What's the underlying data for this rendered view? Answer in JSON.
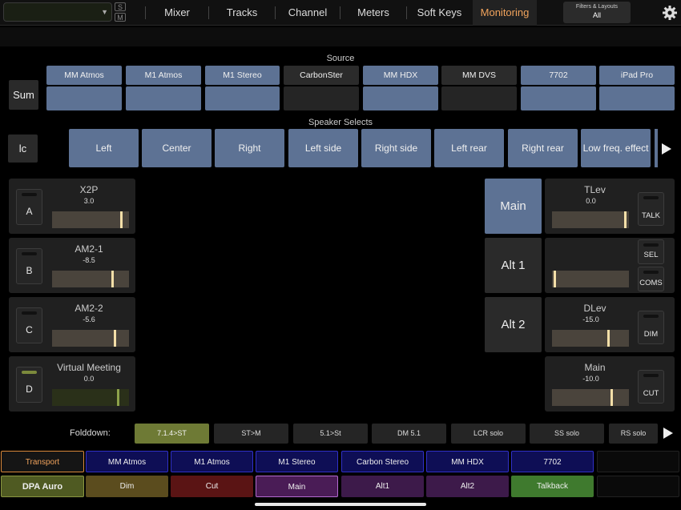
{
  "topbar": {
    "dropdown_value": "",
    "s_label": "S",
    "m_label": "M",
    "tabs": [
      "Mixer",
      "Tracks",
      "Channel",
      "Meters",
      "Soft Keys",
      "Monitoring"
    ],
    "filters_title": "Filters & Layouts",
    "filters_value": "All"
  },
  "source": {
    "title": "Source",
    "sum_label": "Sum",
    "buttons": [
      "MM Atmos",
      "M1 Atmos",
      "M1 Stereo",
      "CarbonSter",
      "MM HDX",
      "MM DVS",
      "7702",
      "iPad Pro"
    ]
  },
  "speakers": {
    "title": "Speaker Selects",
    "side_label": "lc",
    "buttons": [
      "Left",
      "Center",
      "Right",
      "Left side",
      "Right side",
      "Left rear",
      "Right rear",
      "Low freq. effect"
    ]
  },
  "inputs": [
    {
      "letter": "A",
      "name": "X2P",
      "value": "3.0",
      "level": 0.91
    },
    {
      "letter": "B",
      "name": "AM2-1",
      "value": "-8.5",
      "level": 0.8
    },
    {
      "letter": "C",
      "name": "AM2-2",
      "value": "-5.6",
      "level": 0.83
    },
    {
      "letter": "D",
      "name": "Virtual Meeting",
      "value": "0.0",
      "level": 0.87
    }
  ],
  "outputs": {
    "main": "Main",
    "alt1": "Alt 1",
    "alt2": "Alt 2"
  },
  "levels": [
    {
      "name": "TLev",
      "value": "0.0",
      "button": "TALK",
      "level": 0.97
    },
    {
      "name": "",
      "value": "",
      "button": "SEL",
      "button2": "COMS",
      "level": 0.02
    },
    {
      "name": "DLev",
      "value": "-15.0",
      "button": "DIM",
      "level": 0.74
    },
    {
      "name": "Main",
      "value": "-10.0",
      "button": "CUT",
      "level": 0.79
    }
  ],
  "folddown": {
    "label": "Folddown:",
    "buttons": [
      "7.1.4>ST",
      "ST>M",
      "5.1>St",
      "DM 5.1",
      "LCR solo",
      "SS solo",
      "RS solo"
    ]
  },
  "bottom": {
    "row1": [
      "Transport",
      "MM Atmos",
      "M1 Atmos",
      "M1 Stereo",
      "Carbon Stereo",
      "MM HDX",
      "7702",
      ""
    ],
    "row2": [
      "DPA Auro",
      "Dim",
      "Cut",
      "Main",
      "Alt1",
      "Alt2",
      "Talkback",
      ""
    ]
  },
  "colors": {
    "accent_tab": "#f1a35c",
    "source_button": "#5d7294",
    "folddown_active": "#6e7a35"
  }
}
